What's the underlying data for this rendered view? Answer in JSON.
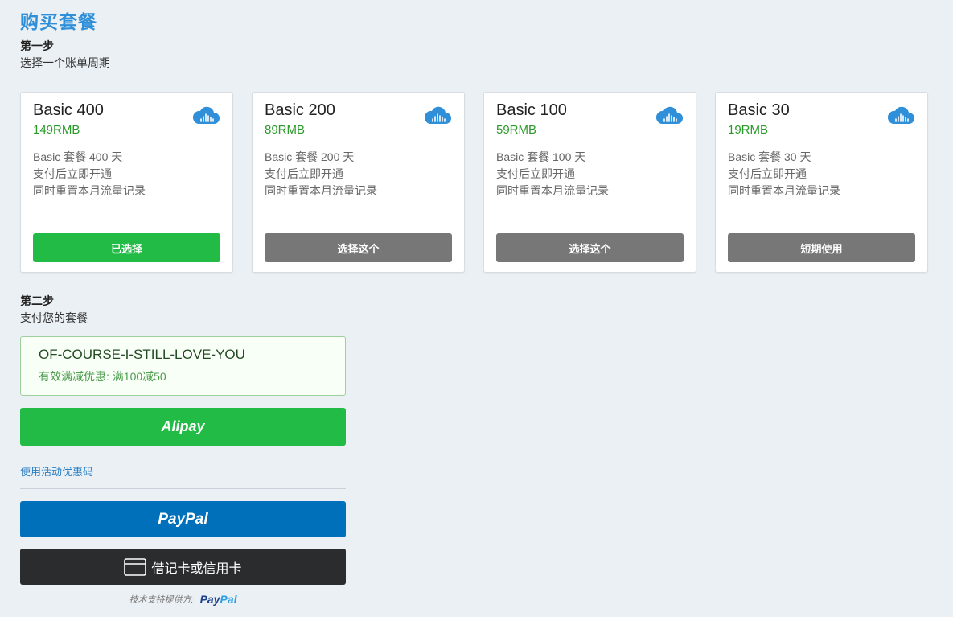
{
  "page": {
    "title": "购买套餐"
  },
  "step1": {
    "heading": "第一步",
    "subtitle": "选择一个账单周期"
  },
  "plans": [
    {
      "name": "Basic 400",
      "price": "149RMB",
      "desc": [
        "Basic 套餐 400 天",
        "支付后立即开通",
        "同时重置本月流量记录"
      ],
      "button": "已选择",
      "selected": true
    },
    {
      "name": "Basic 200",
      "price": "89RMB",
      "desc": [
        "Basic 套餐 200 天",
        "支付后立即开通",
        "同时重置本月流量记录"
      ],
      "button": "选择这个",
      "selected": false
    },
    {
      "name": "Basic 100",
      "price": "59RMB",
      "desc": [
        "Basic 套餐 100 天",
        "支付后立即开通",
        "同时重置本月流量记录"
      ],
      "button": "选择这个",
      "selected": false
    },
    {
      "name": "Basic 30",
      "price": "19RMB",
      "desc": [
        "Basic 套餐 30 天",
        "支付后立即开通",
        "同时重置本月流量记录"
      ],
      "button": "短期使用",
      "selected": false
    }
  ],
  "step2": {
    "heading": "第二步",
    "subtitle": "支付您的套餐"
  },
  "coupon": {
    "code": "OF-COURSE-I-STILL-LOVE-YOU",
    "note": "有效满减优惠: 满100减50"
  },
  "payment": {
    "alipay_label": "Alipay",
    "promo_link": "使用活动优惠码",
    "paypal_label": "PayPal",
    "card_label": "借记卡或信用卡",
    "powered_by": "技术支持提供方:",
    "powered_logo_pay": "Pay",
    "powered_logo_pal": "Pal"
  },
  "colors": {
    "accent": "#2f8fd8",
    "selected": "#22bb45",
    "unselected": "#777777",
    "paypal": "#0070ba",
    "price": "#2a9a2a"
  },
  "icons": {
    "plan": "cloud-icon",
    "card": "credit-card-icon"
  }
}
